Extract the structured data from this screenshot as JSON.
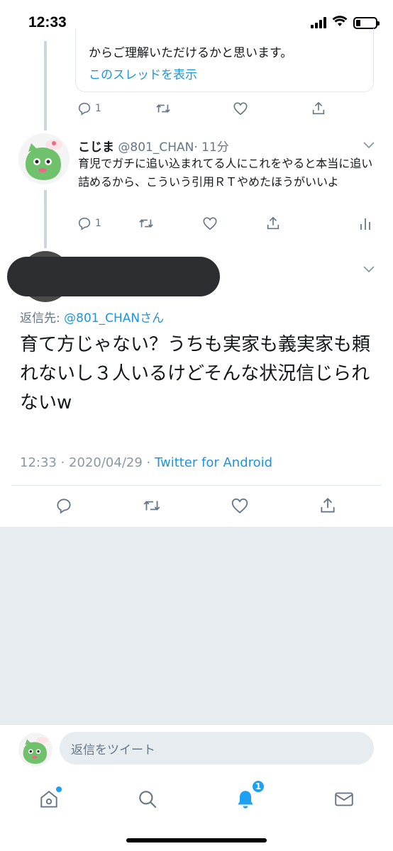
{
  "status_bar": {
    "time": "12:33"
  },
  "quoted_card": {
    "text": "からご理解いただけるかと思います。",
    "show_thread": "このスレッドを表示"
  },
  "tweet1_actions": {
    "reply_count": "1"
  },
  "reply_tweet": {
    "name": "こじま",
    "handle": "@801_CHAN",
    "time": "· 11分",
    "body": "育児でガチに追い込まれてる人にこれをやると本当に追い詰めるから、こういう引用ＲＴやめたほうがいいよ",
    "reply_count": "1"
  },
  "main_tweet": {
    "reply_to_label": "返信先: ",
    "reply_to_mention": "@801_CHANさん",
    "body": "育て方じゃない？うちも実家も義実家も頼れないし３人いるけどそんな状況信じられないw",
    "timestamp": "12:33 · 2020/04/29 · ",
    "source": "Twitter for Android"
  },
  "reply_bar": {
    "placeholder": "返信をツイート"
  },
  "tab_bar": {
    "notifications_badge": "1"
  },
  "colors": {
    "accent": "#1da1f2",
    "link": "#1b95e0",
    "muted": "#657786",
    "background_empty": "#e6ecf0"
  },
  "icons": [
    "reply-icon",
    "retweet-icon",
    "like-icon",
    "share-icon",
    "analytics-icon",
    "chevron-down-icon",
    "home-icon",
    "search-icon",
    "bell-icon",
    "mail-icon"
  ]
}
